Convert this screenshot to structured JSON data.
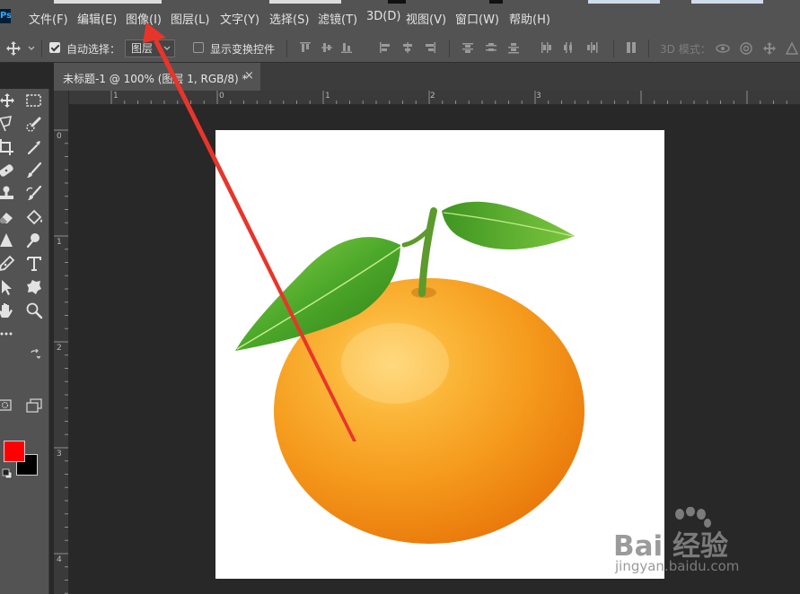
{
  "app": {
    "logo_text": "Ps"
  },
  "menu": {
    "items": [
      {
        "label": "文件(F)"
      },
      {
        "label": "编辑(E)"
      },
      {
        "label": "图像(I)"
      },
      {
        "label": "图层(L)"
      },
      {
        "label": "文字(Y)"
      },
      {
        "label": "选择(S)"
      },
      {
        "label": "滤镜(T)"
      },
      {
        "label": "3D(D)"
      },
      {
        "label": "视图(V)"
      },
      {
        "label": "窗口(W)"
      },
      {
        "label": "帮助(H)"
      }
    ]
  },
  "options": {
    "auto_select_label": "自动选择：",
    "auto_select_checked": true,
    "layer_select_value": "图层",
    "show_transform_label": "显示变换控件",
    "show_transform_checked": false,
    "mode_3d_label": "3D 模式："
  },
  "document_tab": {
    "title": "未标题-1 @ 100% (图层 1, RGB/8) *",
    "close_glyph": "×"
  },
  "rulers": {
    "horizontal_labels": [
      "1",
      "0",
      "1",
      "2",
      "3"
    ],
    "vertical_labels": [
      "0",
      "1",
      "2",
      "3",
      "4"
    ]
  },
  "colors": {
    "foreground": "#ff0000",
    "background": "#000000",
    "annotation_arrow": "#e8352a"
  },
  "watermark": {
    "brand": "Bai 经验",
    "url": "jingyan.baidu.com"
  },
  "icons": {
    "move_tool": "move-icon",
    "marquee_tool": "marquee-icon",
    "lasso_tool": "lasso-icon",
    "quick_select_tool": "quick-select-icon",
    "crop_tool": "crop-icon",
    "eyedropper_tool": "eyedropper-icon",
    "healing_tool": "healing-brush-icon",
    "brush_tool": "brush-icon",
    "stamp_tool": "clone-stamp-icon",
    "history_brush_tool": "history-brush-icon",
    "eraser_tool": "eraser-icon",
    "bucket_tool": "paint-bucket-icon",
    "sharpen_tool": "sharpen-icon",
    "dodge_tool": "dodge-icon",
    "pen_tool": "pen-icon",
    "type_tool": "type-icon",
    "path_select_tool": "path-select-icon",
    "shape_tool": "custom-shape-icon",
    "hand_tool": "hand-icon",
    "zoom_tool": "zoom-icon"
  }
}
